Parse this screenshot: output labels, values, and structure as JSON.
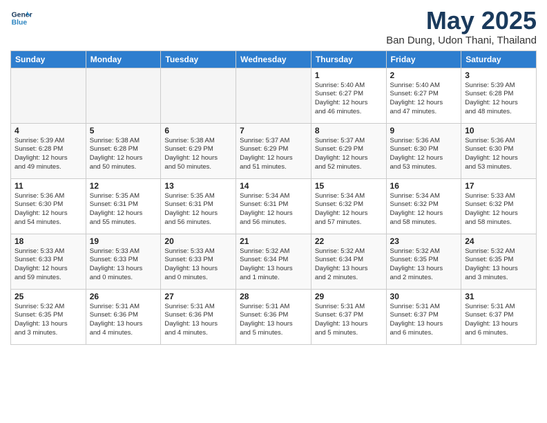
{
  "logo": {
    "line1": "General",
    "line2": "Blue"
  },
  "title": "May 2025",
  "location": "Ban Dung, Udon Thani, Thailand",
  "weekdays": [
    "Sunday",
    "Monday",
    "Tuesday",
    "Wednesday",
    "Thursday",
    "Friday",
    "Saturday"
  ],
  "weeks": [
    [
      {
        "day": "",
        "info": ""
      },
      {
        "day": "",
        "info": ""
      },
      {
        "day": "",
        "info": ""
      },
      {
        "day": "",
        "info": ""
      },
      {
        "day": "1",
        "info": "Sunrise: 5:40 AM\nSunset: 6:27 PM\nDaylight: 12 hours\nand 46 minutes."
      },
      {
        "day": "2",
        "info": "Sunrise: 5:40 AM\nSunset: 6:27 PM\nDaylight: 12 hours\nand 47 minutes."
      },
      {
        "day": "3",
        "info": "Sunrise: 5:39 AM\nSunset: 6:28 PM\nDaylight: 12 hours\nand 48 minutes."
      }
    ],
    [
      {
        "day": "4",
        "info": "Sunrise: 5:39 AM\nSunset: 6:28 PM\nDaylight: 12 hours\nand 49 minutes."
      },
      {
        "day": "5",
        "info": "Sunrise: 5:38 AM\nSunset: 6:28 PM\nDaylight: 12 hours\nand 50 minutes."
      },
      {
        "day": "6",
        "info": "Sunrise: 5:38 AM\nSunset: 6:29 PM\nDaylight: 12 hours\nand 50 minutes."
      },
      {
        "day": "7",
        "info": "Sunrise: 5:37 AM\nSunset: 6:29 PM\nDaylight: 12 hours\nand 51 minutes."
      },
      {
        "day": "8",
        "info": "Sunrise: 5:37 AM\nSunset: 6:29 PM\nDaylight: 12 hours\nand 52 minutes."
      },
      {
        "day": "9",
        "info": "Sunrise: 5:36 AM\nSunset: 6:30 PM\nDaylight: 12 hours\nand 53 minutes."
      },
      {
        "day": "10",
        "info": "Sunrise: 5:36 AM\nSunset: 6:30 PM\nDaylight: 12 hours\nand 53 minutes."
      }
    ],
    [
      {
        "day": "11",
        "info": "Sunrise: 5:36 AM\nSunset: 6:30 PM\nDaylight: 12 hours\nand 54 minutes."
      },
      {
        "day": "12",
        "info": "Sunrise: 5:35 AM\nSunset: 6:31 PM\nDaylight: 12 hours\nand 55 minutes."
      },
      {
        "day": "13",
        "info": "Sunrise: 5:35 AM\nSunset: 6:31 PM\nDaylight: 12 hours\nand 56 minutes."
      },
      {
        "day": "14",
        "info": "Sunrise: 5:34 AM\nSunset: 6:31 PM\nDaylight: 12 hours\nand 56 minutes."
      },
      {
        "day": "15",
        "info": "Sunrise: 5:34 AM\nSunset: 6:32 PM\nDaylight: 12 hours\nand 57 minutes."
      },
      {
        "day": "16",
        "info": "Sunrise: 5:34 AM\nSunset: 6:32 PM\nDaylight: 12 hours\nand 58 minutes."
      },
      {
        "day": "17",
        "info": "Sunrise: 5:33 AM\nSunset: 6:32 PM\nDaylight: 12 hours\nand 58 minutes."
      }
    ],
    [
      {
        "day": "18",
        "info": "Sunrise: 5:33 AM\nSunset: 6:33 PM\nDaylight: 12 hours\nand 59 minutes."
      },
      {
        "day": "19",
        "info": "Sunrise: 5:33 AM\nSunset: 6:33 PM\nDaylight: 13 hours\nand 0 minutes."
      },
      {
        "day": "20",
        "info": "Sunrise: 5:33 AM\nSunset: 6:33 PM\nDaylight: 13 hours\nand 0 minutes."
      },
      {
        "day": "21",
        "info": "Sunrise: 5:32 AM\nSunset: 6:34 PM\nDaylight: 13 hours\nand 1 minute."
      },
      {
        "day": "22",
        "info": "Sunrise: 5:32 AM\nSunset: 6:34 PM\nDaylight: 13 hours\nand 2 minutes."
      },
      {
        "day": "23",
        "info": "Sunrise: 5:32 AM\nSunset: 6:35 PM\nDaylight: 13 hours\nand 2 minutes."
      },
      {
        "day": "24",
        "info": "Sunrise: 5:32 AM\nSunset: 6:35 PM\nDaylight: 13 hours\nand 3 minutes."
      }
    ],
    [
      {
        "day": "25",
        "info": "Sunrise: 5:32 AM\nSunset: 6:35 PM\nDaylight: 13 hours\nand 3 minutes."
      },
      {
        "day": "26",
        "info": "Sunrise: 5:31 AM\nSunset: 6:36 PM\nDaylight: 13 hours\nand 4 minutes."
      },
      {
        "day": "27",
        "info": "Sunrise: 5:31 AM\nSunset: 6:36 PM\nDaylight: 13 hours\nand 4 minutes."
      },
      {
        "day": "28",
        "info": "Sunrise: 5:31 AM\nSunset: 6:36 PM\nDaylight: 13 hours\nand 5 minutes."
      },
      {
        "day": "29",
        "info": "Sunrise: 5:31 AM\nSunset: 6:37 PM\nDaylight: 13 hours\nand 5 minutes."
      },
      {
        "day": "30",
        "info": "Sunrise: 5:31 AM\nSunset: 6:37 PM\nDaylight: 13 hours\nand 6 minutes."
      },
      {
        "day": "31",
        "info": "Sunrise: 5:31 AM\nSunset: 6:37 PM\nDaylight: 13 hours\nand 6 minutes."
      }
    ]
  ]
}
